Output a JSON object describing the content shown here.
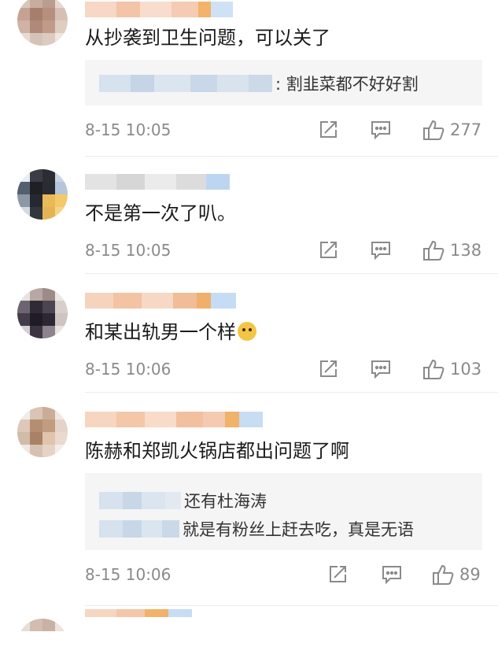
{
  "colors": {
    "like": "#8a8a8a",
    "reply_bg": "#f5f5f5",
    "divider": "#ececec"
  },
  "comments": [
    {
      "text": "从抄袭到卫生问题，可以关了",
      "replies": [
        {
          "text": ": 割韭菜都不好好割"
        }
      ],
      "time": "8-15 10:05",
      "likes": "277"
    },
    {
      "text": "不是第一次了叭。",
      "replies": [],
      "time": "8-15 10:05",
      "likes": "138"
    },
    {
      "text": "和某出轨男一个样",
      "emoji": "doge-emoji",
      "replies": [],
      "time": "8-15 10:06",
      "likes": "103"
    },
    {
      "text": "陈赫和郑凯火锅店都出问题了啊",
      "replies": [
        {
          "text": "还有杜海涛"
        },
        {
          "text": "就是有粉丝上赶去吃，真是无语"
        }
      ],
      "time": "8-15 10:06",
      "likes": "89"
    }
  ],
  "icons": {
    "share": "share-icon",
    "comment": "comment-icon",
    "like": "thumbs-up-icon"
  }
}
